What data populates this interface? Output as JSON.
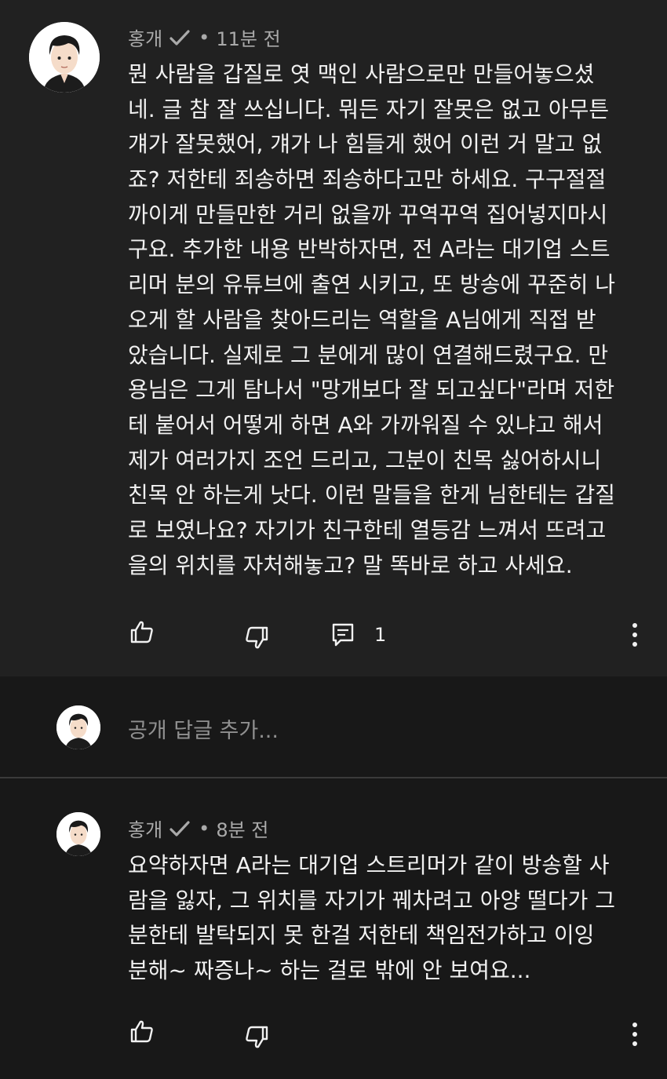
{
  "comment": {
    "author": "홍개",
    "time": "11분 전",
    "lines": [
      "뭔 사람을 갑질로 엿 맥인 사람으로만 만들어놓으셨",
      "네. 글 참 잘 쓰십니다. 뭐든 자기 잘못은 없고 아무튼",
      "걔가 잘못했어, 걔가 나 힘들게 했어 이런 거 말고 없",
      "죠? 저한테 죄송하면 죄송하다고만 하세요. 구구절절",
      "까이게 만들만한 거리 없을까 꾸역꾸역 집어넣지마시",
      "구요. 추가한 내용 반박하자면, 전 A라는 대기업 스트",
      "리머 분의 유튜브에 출연 시키고, 또 방송에 꾸준히 나",
      "오게 할 사람을 찾아드리는 역할을 A님에게 직접 받",
      "았습니다. 실제로 그 분에게 많이 연결해드렸구요. 만",
      "용님은 그게 탐나서 \"망개보다 잘 되고싶다\"라며 저한",
      "테 붙어서 어떻게 하면 A와 가까워질 수 있냐고 해서",
      "제가 여러가지 조언 드리고, 그분이 친목 싫어하시니",
      "친목 안 하는게 낫다. 이런 말들을 한게 님한테는 갑질",
      "로 보였나요? 자기가 친구한테 열등감 느껴서 뜨려고",
      "을의 위치를 자처해놓고? 말 똑바로 하고 사세요."
    ],
    "reply_count": "1"
  },
  "reply_box": {
    "placeholder": "공개 답글 추가..."
  },
  "reply": {
    "author": "홍개",
    "time": "8분 전",
    "lines": [
      "요약하자면 A라는 대기업 스트리머가 같이 방송할 사",
      "람을 잃자, 그 위치를 자기가 꿰차려고 아양 떨다가 그",
      "분한테 발탁되지 못 한걸 저한테 책임전가하고 이잉",
      "분해~ 짜증나~ 하는 걸로 밖에 안 보여요..."
    ]
  },
  "icons": {
    "like": "thumbs-up-icon",
    "dislike": "thumbs-down-icon",
    "replies": "comment-icon",
    "more": "more-vertical-icon",
    "verified": "checkmark-icon"
  },
  "colors": {
    "background": "#212121",
    "text": "#f1f1f1",
    "meta": "#aaaaaa",
    "placeholder": "#909090"
  }
}
